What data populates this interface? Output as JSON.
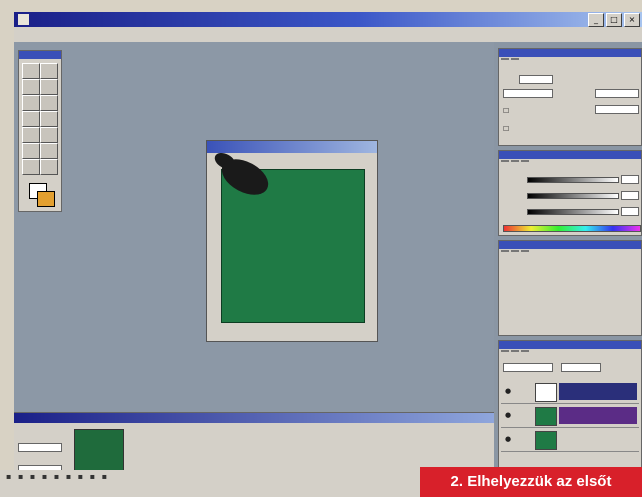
{
  "window": {
    "title": ""
  },
  "menubar": {
    "items": [
      "",
      "",
      "",
      "",
      "",
      "",
      "",
      ""
    ]
  },
  "document": {
    "title": "",
    "zoom": ""
  },
  "colors": {
    "workspace": "#8c98a6",
    "canvas": "#1f7a45",
    "titlebar": "#1a1f88",
    "caption_bg": "#d8202a",
    "caption_text": "#ffffff",
    "foreground_swatch": "#ffffff",
    "background_swatch": "#e3a030"
  },
  "icons": [
    "app-icon",
    "minimize-icon",
    "maximize-icon",
    "close-icon",
    "pen-cursor-icon"
  ],
  "caption": {
    "text": "2. Elhelyezzük az elsőt"
  }
}
